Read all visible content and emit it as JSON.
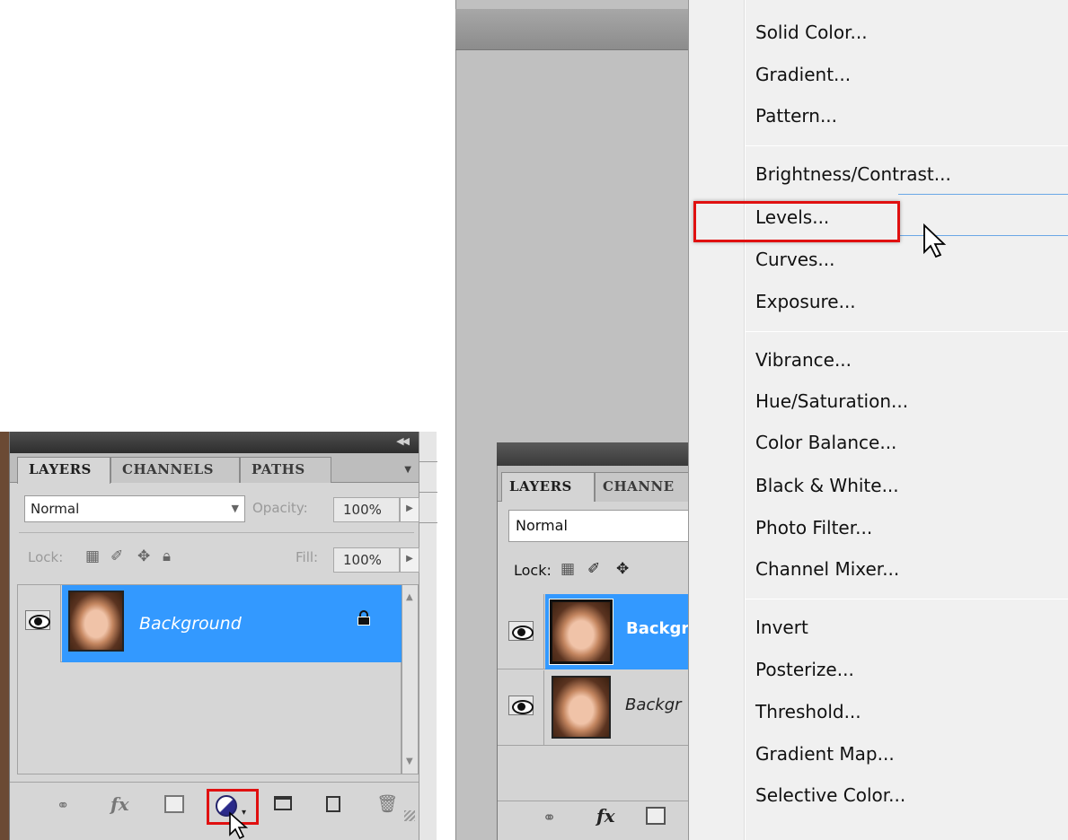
{
  "left_panel": {
    "tabs": [
      "LAYERS",
      "CHANNELS",
      "PATHS"
    ],
    "blend_mode": "Normal",
    "opacity_label": "Opacity:",
    "opacity_value": "100%",
    "lock_label": "Lock:",
    "fill_label": "Fill:",
    "fill_value": "100%",
    "layer_name": "Background",
    "bottom_icons": [
      "link-icon",
      "fx-icon",
      "mask-icon",
      "adjustment-layer-icon",
      "folder-icon",
      "new-layer-icon",
      "trash-icon"
    ],
    "fx_label": "fx"
  },
  "right_panel": {
    "tabs": [
      "LAYERS",
      "CHANNE"
    ],
    "blend_mode": "Normal",
    "lock_label": "Lock:",
    "layers": [
      {
        "name": "Backgr",
        "selected": true
      },
      {
        "name": "Backgr",
        "selected": false
      }
    ],
    "fx_label": "fx"
  },
  "menu": {
    "groups": [
      [
        "Solid Color...",
        "Gradient...",
        "Pattern..."
      ],
      [
        "Brightness/Contrast...",
        "Levels...",
        "Curves...",
        "Exposure..."
      ],
      [
        "Vibrance...",
        "Hue/Saturation...",
        "Color Balance...",
        "Black & White...",
        "Photo Filter...",
        "Channel Mixer..."
      ],
      [
        "Invert",
        "Posterize...",
        "Threshold...",
        "Gradient Map...",
        "Selective Color..."
      ]
    ],
    "highlighted_item": "Levels...",
    "highlight_color": "#e01010"
  },
  "colors": {
    "selection_blue": "#3399ff",
    "panel_gray": "#d6d6d6"
  }
}
